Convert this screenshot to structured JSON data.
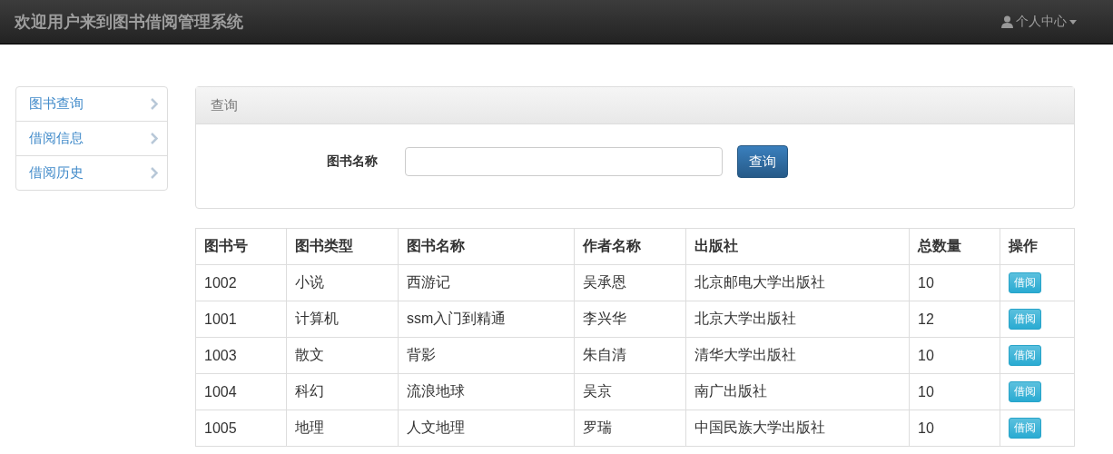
{
  "navbar": {
    "title": "欢迎用户来到图书借阅管理系统",
    "user_menu": "个人中心"
  },
  "sidebar": {
    "items": [
      {
        "label": "图书查询"
      },
      {
        "label": "借阅信息"
      },
      {
        "label": "借阅历史"
      }
    ]
  },
  "search_panel": {
    "heading": "查询",
    "field_label": "图书名称",
    "button": "查询"
  },
  "table": {
    "columns": [
      "图书号",
      "图书类型",
      "图书名称",
      "作者名称",
      "出版社",
      "总数量",
      "操作"
    ],
    "rows": [
      {
        "cells": [
          "1002",
          "小说",
          "西游记",
          "吴承恩",
          "北京邮电大学出版社",
          "10"
        ],
        "action": "借阅"
      },
      {
        "cells": [
          "1001",
          "计算机",
          "ssm入门到精通",
          "李兴华",
          "北京大学出版社",
          "12"
        ],
        "action": "借阅"
      },
      {
        "cells": [
          "1003",
          "散文",
          "背影",
          "朱自清",
          "清华大学出版社",
          "10"
        ],
        "action": "借阅"
      },
      {
        "cells": [
          "1004",
          "科幻",
          "流浪地球",
          "吴京",
          "南广出版社",
          "10"
        ],
        "action": "借阅"
      },
      {
        "cells": [
          "1005",
          "地理",
          "人文地理",
          "罗瑞",
          "中国民族大学出版社",
          "10"
        ],
        "action": "借阅"
      }
    ]
  }
}
